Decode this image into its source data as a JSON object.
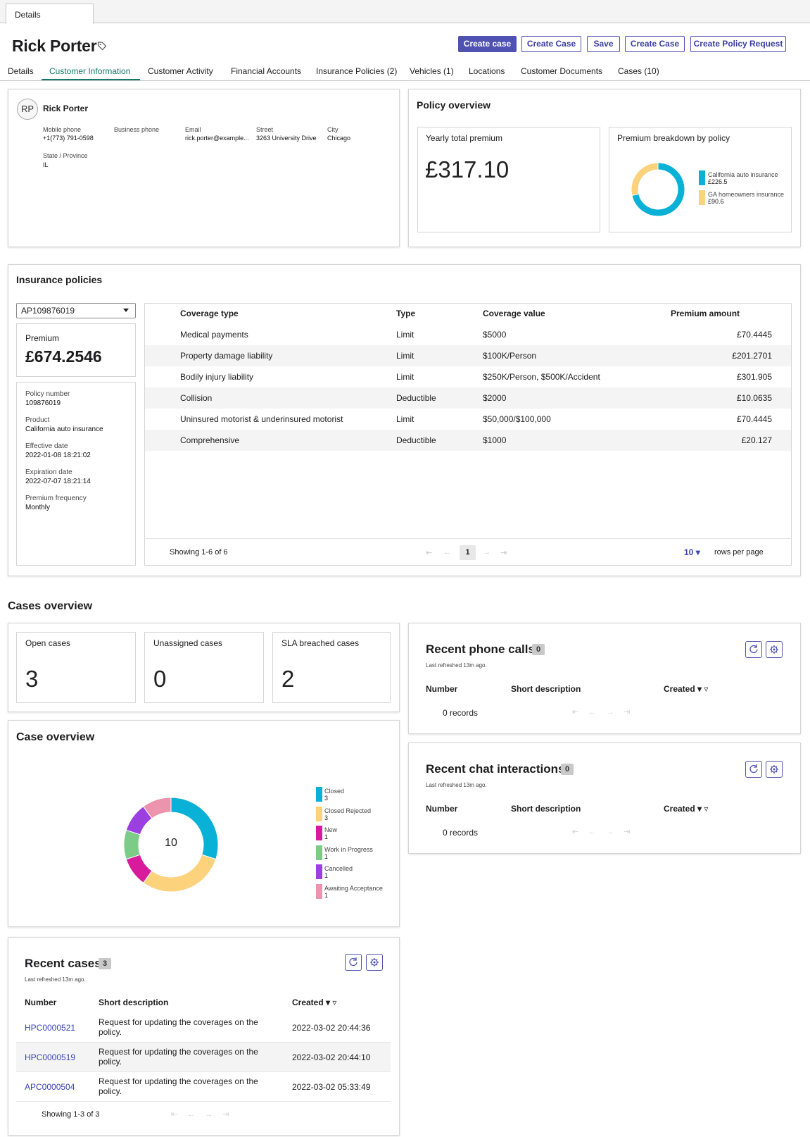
{
  "top_tab": {
    "label": "Details"
  },
  "header": {
    "title": "Rick Porter",
    "buttons": [
      "Create case",
      "Create Case",
      "Save",
      "Create Case",
      "Create Policy Request"
    ]
  },
  "nav_tabs": [
    "Details",
    "Customer Information",
    "Customer Activity",
    "Financial Accounts",
    "Insurance Policies (2)",
    "Vehicles (1)",
    "Locations",
    "Customer Documents",
    "Cases (10)"
  ],
  "contact": {
    "initials": "RP",
    "name": "Rick Porter",
    "mobile_label": "Mobile phone",
    "mobile": "+1(773) 791-0598",
    "business_label": "Business phone",
    "email_label": "Email",
    "email": "rick.porter@example...",
    "street_label": "Street",
    "street": "3263 University Drive",
    "city_label": "City",
    "city": "Chicago",
    "state_label": "State / Province",
    "state": "IL"
  },
  "policy_overview": {
    "title": "Policy overview",
    "yearly_label": "Yearly total premium",
    "yearly_value": "£317.10",
    "breakdown_label": "Premium breakdown by policy",
    "legend": [
      {
        "name": "California auto insurance",
        "value": "£226.5",
        "color": "#08b1d5"
      },
      {
        "name": "GA homeowners insurance",
        "value": "£90.6",
        "color": "#fdd27d"
      }
    ]
  },
  "insurance": {
    "title": "Insurance policies",
    "selected_policy": "AP109876019",
    "premium_label": "Premium",
    "premium_value": "£674.2546",
    "details": [
      {
        "label": "Policy number",
        "value": "109876019"
      },
      {
        "label": "Product",
        "value": "California auto insurance"
      },
      {
        "label": "Effective date",
        "value": "2022-01-08 18:21:02"
      },
      {
        "label": "Expiration date",
        "value": "2022-07-07 18:21:14"
      },
      {
        "label": "Premium frequency",
        "value": "Monthly"
      }
    ],
    "columns": [
      "Coverage type",
      "Type",
      "Coverage value",
      "Premium amount"
    ],
    "rows": [
      [
        "Medical payments",
        "Limit",
        "$5000",
        "£70.4445"
      ],
      [
        "Property damage liability",
        "Limit",
        "$100K/Person",
        "£201.2701"
      ],
      [
        "Bodily injury liability",
        "Limit",
        "$250K/Person, $500K/Accident",
        "£301.905"
      ],
      [
        "Collision",
        "Deductible",
        "$2000",
        "£10.0635"
      ],
      [
        "Uninsured motorist & underinsured motorist",
        "Limit",
        "$50,000/$100,000",
        "£70.4445"
      ],
      [
        "Comprehensive",
        "Deductible",
        "$1000",
        "£20.127"
      ]
    ],
    "showing": "Showing 1-6 of 6",
    "page": "1",
    "rows_per_page_value": "10",
    "rows_per_page_label": "rows per page"
  },
  "cases_overview": {
    "title": "Cases overview",
    "kpis": [
      {
        "label": "Open cases",
        "value": "3"
      },
      {
        "label": "Unassigned cases",
        "value": "0"
      },
      {
        "label": "SLA breached cases",
        "value": "2"
      }
    ]
  },
  "case_overview": {
    "title": "Case overview",
    "total": "10"
  },
  "chart_data": [
    {
      "type": "pie",
      "categories": [
        "California auto insurance",
        "GA homeowners insurance"
      ],
      "values": [
        226.5,
        90.6
      ],
      "colors": [
        "#08b1d5",
        "#fdd27d"
      ]
    },
    {
      "type": "pie",
      "categories": [
        "Closed",
        "Closed Rejected",
        "New",
        "Work in Progress",
        "Cancelled",
        "Awaiting Acceptance"
      ],
      "values": [
        3,
        3,
        1,
        1,
        1,
        1
      ],
      "colors": [
        "#08b1d5",
        "#fdd27d",
        "#d81b9c",
        "#7ccb87",
        "#9c3fe0",
        "#ec93ad"
      ]
    }
  ],
  "phone_calls": {
    "title": "Recent phone calls",
    "count": "0",
    "refreshed": "Last refreshed 13m ago.",
    "columns": [
      "Number",
      "Short description",
      "Created"
    ],
    "empty": "0 records"
  },
  "chat": {
    "title": "Recent chat interactions",
    "count": "0",
    "refreshed": "Last refreshed 13m ago.",
    "columns": [
      "Number",
      "Short description",
      "Created"
    ],
    "empty": "0 records"
  },
  "recent_cases": {
    "title": "Recent cases",
    "count": "3",
    "refreshed": "Last refreshed 13m ago.",
    "columns": [
      "Number",
      "Short description",
      "Created"
    ],
    "rows": [
      [
        "HPC0000521",
        "Request for updating the coverages on the policy.",
        "2022-03-02 20:44:36"
      ],
      [
        "HPC0000519",
        "Request for updating the coverages on the policy.",
        "2022-03-02 20:44:10"
      ],
      [
        "APC0000504",
        "Request for updating the coverages on the policy.",
        "2022-03-02 05:33:49"
      ]
    ],
    "showing": "Showing 1-3 of 3"
  }
}
